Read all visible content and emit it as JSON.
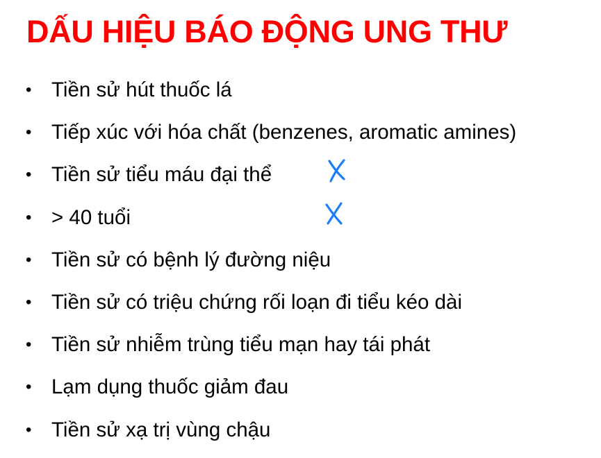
{
  "title": "DẤU HIỆU BÁO ĐỘNG UNG THƯ",
  "bullet_glyph": "•",
  "items": [
    {
      "text": "Tiền sử hút thuốc lá"
    },
    {
      "text": "Tiếp xúc với hóa chất (benzenes, aromatic amines)"
    },
    {
      "text": "Tiền sử tiểu máu đại thể"
    },
    {
      "text": "> 40 tuổi"
    },
    {
      "text": "Tiền sử có bệnh lý đường niệu"
    },
    {
      "text": "Tiền sử có triệu chứng rối loạn đi tiểu kéo dài"
    },
    {
      "text": "Tiền sử nhiễm trùng tiểu mạn hay tái phát"
    },
    {
      "text": "Lạm dụng thuốc giảm đau"
    },
    {
      "text": "Tiền sử xạ trị vùng chậu"
    }
  ],
  "colors": {
    "title": "#ff0000",
    "mark": "#1a7cff"
  }
}
